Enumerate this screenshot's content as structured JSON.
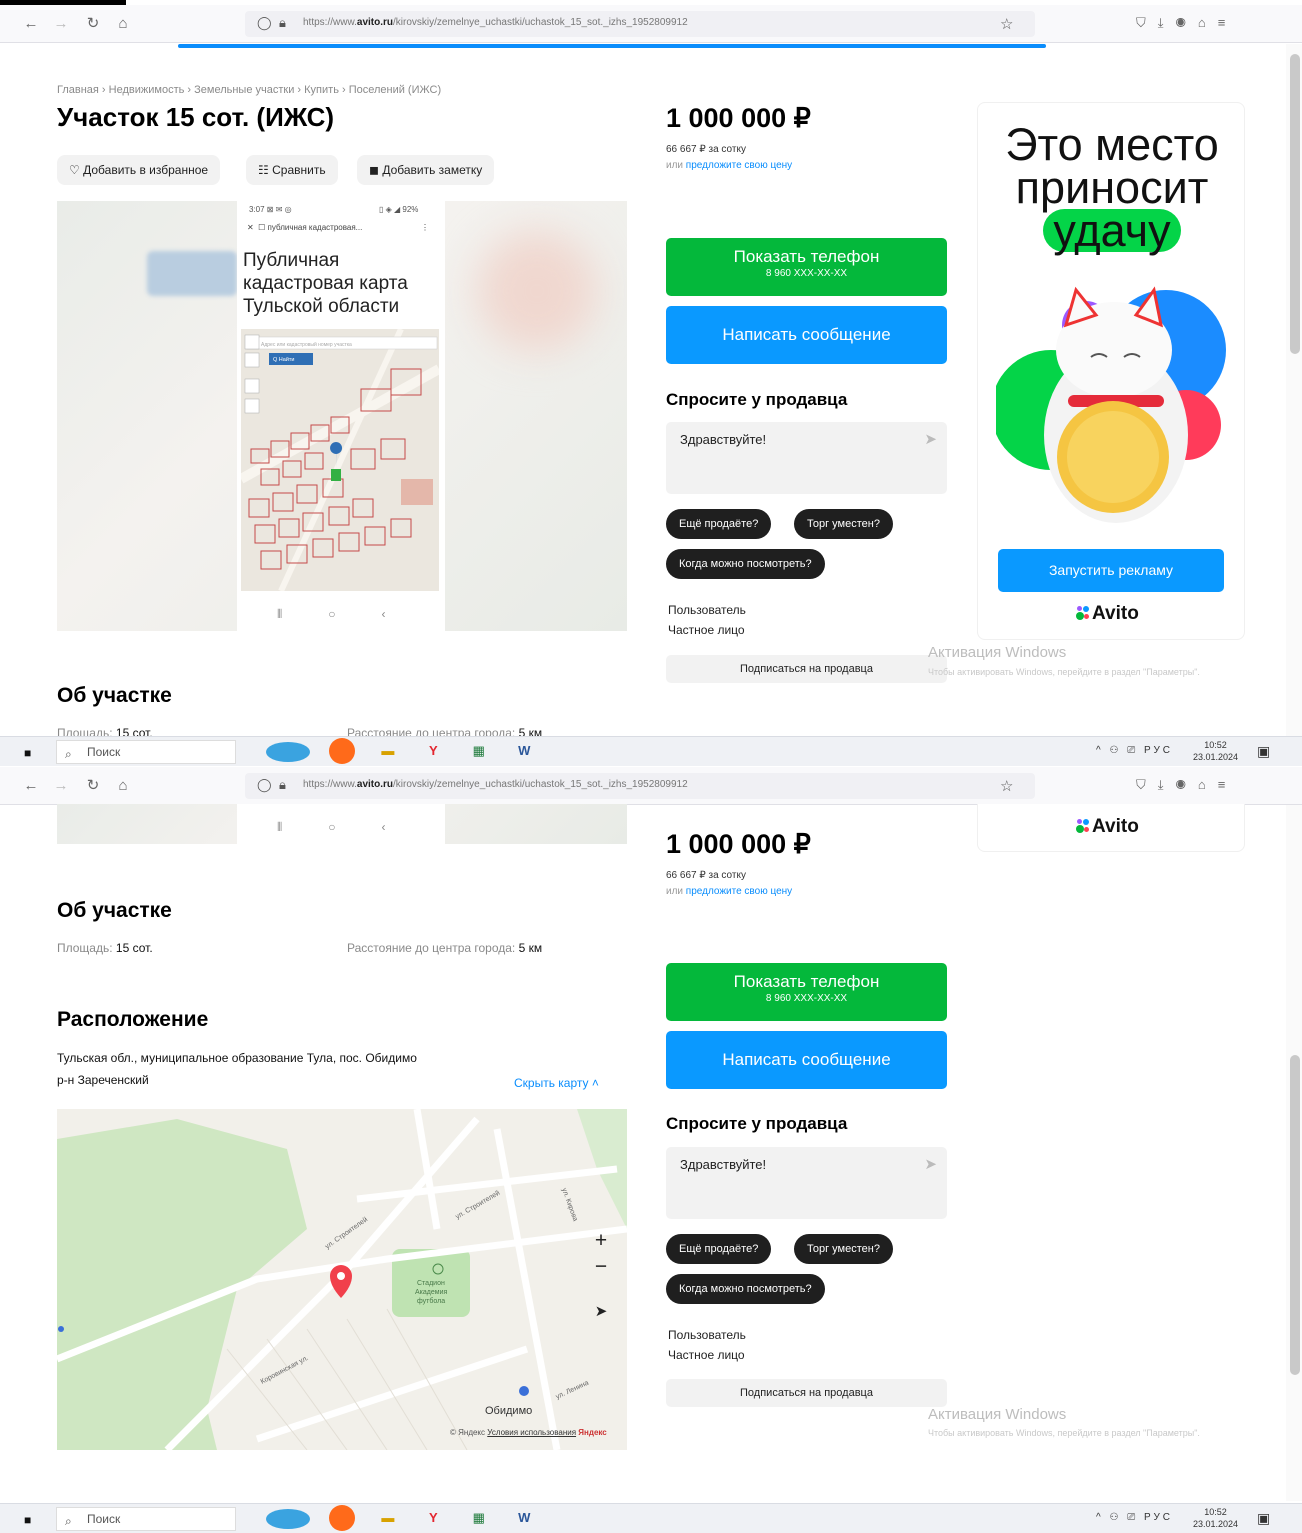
{
  "browser": {
    "url_prefix": "https://www.",
    "url_domain": "avito.ru",
    "url_path": "/kirovskiy/zemelnye_uchastki/uchastok_15_sot._izhs_1952809912"
  },
  "breadcrumbs": [
    "Главная",
    "Недвижимость",
    "Земельные участки",
    "Купить",
    "Поселений (ИЖС)"
  ],
  "title": "Участок 15 сот. (ИЖС)",
  "actions": {
    "favorite": "Добавить в избранное",
    "compare": "Сравнить",
    "note": "Добавить заметку"
  },
  "photo": {
    "status": "3:07 ⊠ ✉ ◎",
    "status_right": "▯ ◈ ◢ 92%",
    "tab_label": "публичная кадастровая...",
    "heading_line1": "Публичная",
    "heading_line2": "кадастровая карта",
    "heading_line3": "Тульской области",
    "search_placeholder": "Адрес или кадастровый номер участка",
    "search_button": "Q Найти"
  },
  "price": {
    "amount": "1 000 000 ₽",
    "per_sotka": "66 667 ₽ за сотку",
    "offer_prefix": "или",
    "offer_link": "предложите свою цену"
  },
  "contact": {
    "show_phone": "Показать телефон",
    "phone_masked": "8 960 XXX-XX-XX",
    "write_message": "Написать сообщение",
    "ask_heading": "Спросите у продавца",
    "ask_placeholder": "Здравствуйте!",
    "chips": [
      "Ещё продаёте?",
      "Торг уместен?",
      "Когда можно посмотреть?"
    ],
    "seller_name": "Пользователь",
    "seller_type": "Частное лицо",
    "subscribe": "Подписаться на продавца"
  },
  "ad": {
    "line1": "Это место",
    "line2": "приносит",
    "line3": "удачу",
    "button": "Запустить рекламу",
    "logo": "Avito"
  },
  "about": {
    "heading": "Об участке",
    "area_label": "Площадь:",
    "area_value": "15 сот.",
    "distance_label": "Расстояние до центра города:",
    "distance_value": "5 км"
  },
  "location": {
    "heading": "Расположение",
    "address": "Тульская обл., муниципальное образование Тула, пос. Обидимо",
    "district": "р-н Зареченский",
    "hide_map": "Скрыть карту ˄",
    "map_labels": {
      "street1": "ул. Строителей",
      "street2": "ул. Строителей",
      "street3": "Коровинская ул.",
      "street4": "ул. Ленина",
      "street5": "ул. Кирова",
      "stadium1": "Стадион",
      "stadium2": "Академия",
      "stadium3": "футбола",
      "village": "Обидимо",
      "copyright": "© Яндекс",
      "terms": "Условия использования",
      "brand": "Яндекс"
    }
  },
  "windows": {
    "activation_title": "Активация Windows",
    "activation_text": "Чтобы активировать Windows, перейдите в раздел \"Параметры\".",
    "search": "Поиск",
    "lang": "РУС",
    "time": "10:52",
    "date": "23.01.2024"
  },
  "colors": {
    "green": "#04b83b",
    "blue": "#0a99ff",
    "link": "#0a8dfc"
  }
}
